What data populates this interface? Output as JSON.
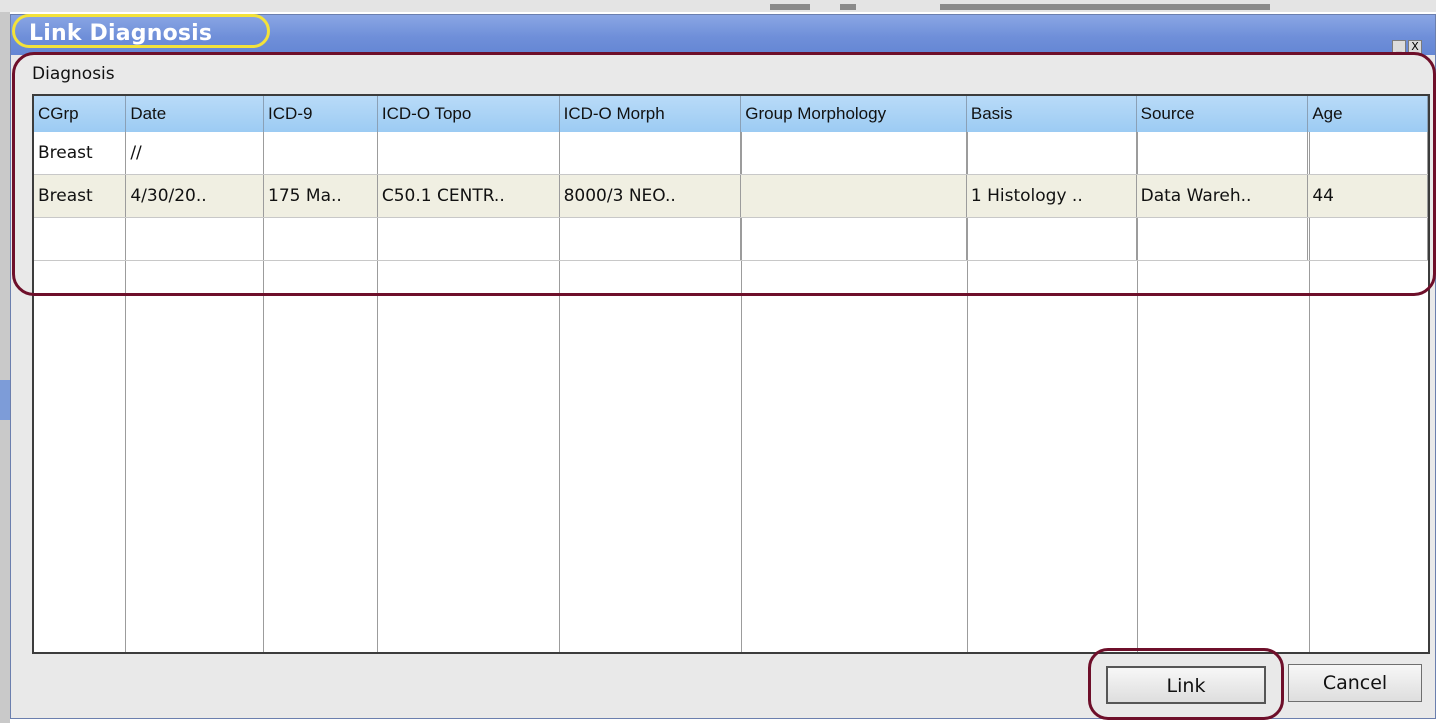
{
  "window": {
    "title": "Link Diagnosis",
    "minimize_glyph": "_",
    "close_glyph": "X",
    "title_bar_color": "#6f8fd9",
    "highlight_yellow": "#f3e23a",
    "highlight_maroon": "#6e0f2a"
  },
  "section": {
    "label": "Diagnosis"
  },
  "table": {
    "columns": [
      "CGrp",
      "Date",
      "ICD-9",
      "ICD-O Topo",
      "ICD-O Morph",
      "Group Morphology",
      "Basis",
      "Source",
      "Age"
    ],
    "rows": [
      [
        "Breast",
        "//",
        "",
        "",
        "",
        "",
        "",
        "",
        ""
      ],
      [
        "Breast",
        "4/30/20..",
        "175 Ma..",
        "C50.1 CENTR..",
        "8000/3 NEO..",
        "",
        "1 Histology ..",
        "Data Wareh..",
        "44"
      ]
    ]
  },
  "buttons": {
    "link_label": "Link",
    "cancel_label": "Cancel"
  }
}
